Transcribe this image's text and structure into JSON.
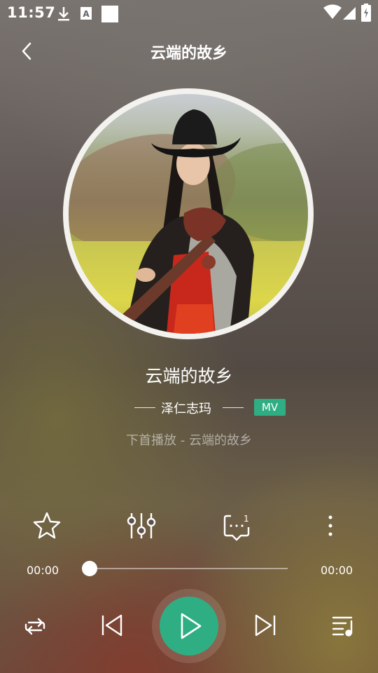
{
  "status_bar": {
    "time": "11:57",
    "icons": [
      "download-icon",
      "text-a-icon",
      "square-icon",
      "wifi-icon",
      "signal-icon",
      "battery-charging-icon"
    ]
  },
  "header": {
    "title": "云端的故乡",
    "back_icon": "chevron-left-icon"
  },
  "song": {
    "title": "云端的故乡",
    "artist": "泽仁志玛",
    "mv_label": "MV",
    "next_info": "下首播放 - 云端的故乡"
  },
  "actions": {
    "favorite_icon": "star-outline-icon",
    "equalizer_icon": "equalizer-icon",
    "comment_icon": "comment-icon",
    "comment_count": "1",
    "more_icon": "more-vertical-icon"
  },
  "progress": {
    "current_time": "00:00",
    "total_time": "00:00",
    "fraction": 0
  },
  "controls": {
    "repeat_icon": "repeat-icon",
    "prev_icon": "skip-previous-icon",
    "play_icon": "play-icon",
    "next_icon": "skip-next-icon",
    "playlist_icon": "playlist-icon"
  },
  "colors": {
    "accent": "#2fae84",
    "mv_badge": "#2fae84"
  }
}
